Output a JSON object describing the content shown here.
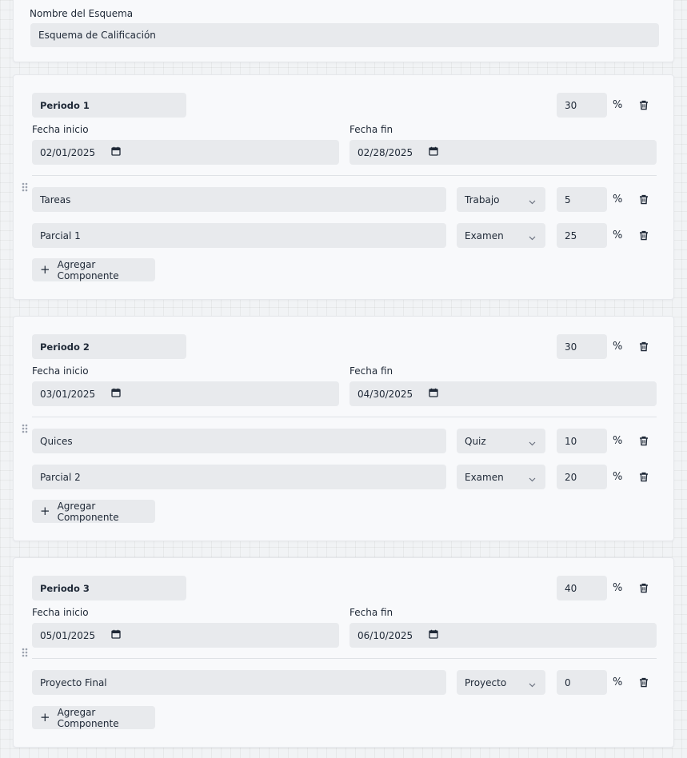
{
  "scheme": {
    "name_label": "Nombre del Esquema",
    "name_value": "Esquema de Calificación"
  },
  "labels": {
    "start_date": "Fecha inicio",
    "end_date": "Fecha fin",
    "percent": "%",
    "add_component": "Agregar Componente"
  },
  "periods": [
    {
      "name": "Periodo 1",
      "weight": "30",
      "start": "02/01/2025",
      "end": "02/28/2025",
      "components": [
        {
          "name": "Tareas",
          "type": "Trabajo",
          "weight": "5"
        },
        {
          "name": "Parcial 1",
          "type": "Examen",
          "weight": "25"
        }
      ]
    },
    {
      "name": "Periodo 2",
      "weight": "30",
      "start": "03/01/2025",
      "end": "04/30/2025",
      "components": [
        {
          "name": "Quices",
          "type": "Quiz",
          "weight": "10"
        },
        {
          "name": "Parcial 2",
          "type": "Examen",
          "weight": "20"
        }
      ]
    },
    {
      "name": "Periodo 3",
      "weight": "40",
      "start": "05/01/2025",
      "end": "06/10/2025",
      "components": [
        {
          "name": "Proyecto Final",
          "type": "Proyecto",
          "weight": "0"
        }
      ]
    }
  ],
  "icons": {
    "trash": "trash-icon",
    "calendar": "calendar-icon",
    "chevron": "chevron-down-icon",
    "drag": "drag-handle-icon",
    "plus": "plus-icon"
  }
}
